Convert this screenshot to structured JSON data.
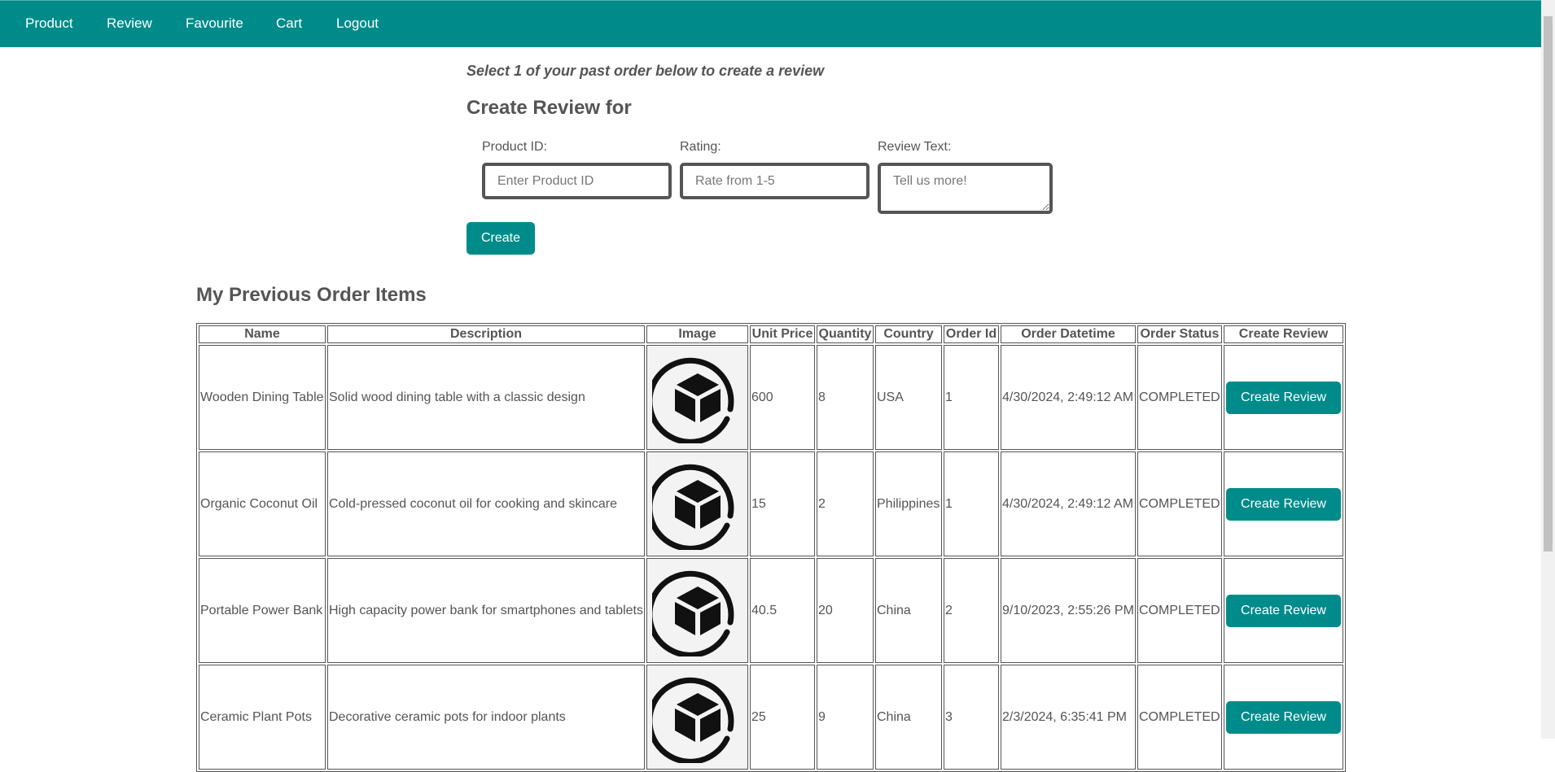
{
  "nav": {
    "items": [
      "Product",
      "Review",
      "Favourite",
      "Cart",
      "Logout"
    ]
  },
  "review_form": {
    "intro": "Select 1 of your past order below to create a review",
    "title": "Create Review for",
    "product_id_label": "Product ID:",
    "product_id_placeholder": "Enter Product ID",
    "rating_label": "Rating:",
    "rating_placeholder": "Rate from 1-5",
    "review_text_label": "Review Text:",
    "review_text_placeholder": "Tell us more!",
    "create_label": "Create"
  },
  "orders": {
    "title": "My Previous Order Items",
    "columns": [
      "Name",
      "Description",
      "Image",
      "Unit Price",
      "Quantity",
      "Country",
      "Order Id",
      "Order Datetime",
      "Order Status",
      "Create Review"
    ],
    "rows": [
      {
        "name": "Wooden Dining Table",
        "description": "Solid wood dining table with a classic design",
        "image_icon": "product-box-icon",
        "unit_price": "600",
        "quantity": "8",
        "country": "USA",
        "order_id": "1",
        "order_datetime": "4/30/2024, 2:49:12 AM",
        "order_status": "COMPLETED",
        "action": "Create Review"
      },
      {
        "name": "Organic Coconut Oil",
        "description": "Cold-pressed coconut oil for cooking and skincare",
        "image_icon": "product-box-icon",
        "unit_price": "15",
        "quantity": "2",
        "country": "Philippines",
        "order_id": "1",
        "order_datetime": "4/30/2024, 2:49:12 AM",
        "order_status": "COMPLETED",
        "action": "Create Review"
      },
      {
        "name": "Portable Power Bank",
        "description": "High capacity power bank for smartphones and tablets",
        "image_icon": "product-box-icon",
        "unit_price": "40.5",
        "quantity": "20",
        "country": "China",
        "order_id": "2",
        "order_datetime": "9/10/2023, 2:55:26 PM",
        "order_status": "COMPLETED",
        "action": "Create Review"
      },
      {
        "name": "Ceramic Plant Pots",
        "description": "Decorative ceramic pots for indoor plants",
        "image_icon": "product-box-icon",
        "unit_price": "25",
        "quantity": "9",
        "country": "China",
        "order_id": "3",
        "order_datetime": "2/3/2024, 6:35:41 PM",
        "order_status": "COMPLETED",
        "action": "Create Review"
      }
    ]
  },
  "colors": {
    "accent": "#008b8b",
    "text": "#555555"
  }
}
